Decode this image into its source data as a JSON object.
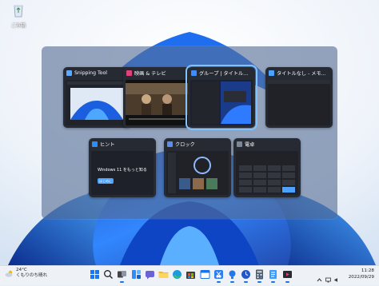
{
  "desktop": {
    "recycle_bin_label": "ごみ箱"
  },
  "switcher": {
    "windows": [
      {
        "title": "Snipping Tool",
        "icon": "snipping-tool-icon",
        "selected": false
      },
      {
        "title": "映画 & テレビ",
        "icon": "movies-tv-icon",
        "selected": false
      },
      {
        "title": "グループ | タイトルな...",
        "icon": "group-icon",
        "selected": true
      },
      {
        "title": "タイトルなし - メモ...",
        "icon": "notepad-icon",
        "selected": false
      },
      {
        "title": "ヒント",
        "icon": "tips-icon",
        "selected": false
      },
      {
        "title": "クロック",
        "icon": "clock-icon",
        "selected": false
      },
      {
        "title": "電卓",
        "icon": "calculator-icon",
        "selected": false
      }
    ],
    "tips_heading": "Windows 11 をもっと知る",
    "tips_button": "はじめに"
  },
  "taskbar": {
    "weather_temp": "24°C",
    "weather_desc": "くもりのち晴れ",
    "icons": [
      "start-icon",
      "search-icon",
      "task-view-icon",
      "widgets-icon",
      "chat-icon",
      "explorer-icon",
      "edge-icon",
      "store-icon",
      "calendar-icon",
      "snipping-tool-icon",
      "tips-icon",
      "clock-icon",
      "calculator-icon",
      "notepad-icon",
      "movies-tv-icon"
    ],
    "time": "11:28",
    "date": "2022/09/29"
  }
}
